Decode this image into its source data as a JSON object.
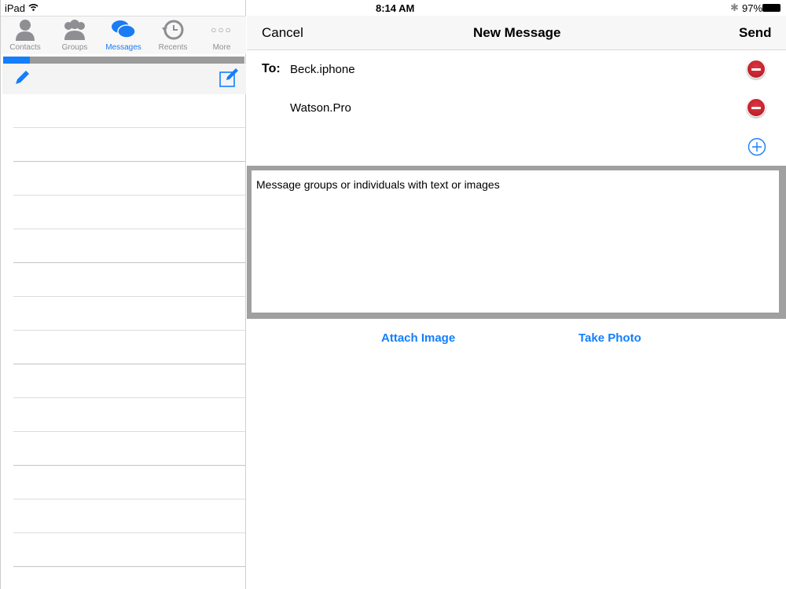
{
  "status": {
    "device": "iPad",
    "time": "8:14 AM",
    "battery": "97%"
  },
  "tabs": [
    {
      "label": "Contacts"
    },
    {
      "label": "Groups"
    },
    {
      "label": "Messages",
      "active": true
    },
    {
      "label": "Recents"
    },
    {
      "label": "More"
    }
  ],
  "progress": {
    "fraction": 0.11
  },
  "nav": {
    "cancel": "Cancel",
    "title": "New Message",
    "send": "Send"
  },
  "recipients": {
    "to_label": "To:",
    "items": [
      "Beck.iphone",
      "Watson.Pro"
    ]
  },
  "message": {
    "text": "Message groups or individuals with text or images"
  },
  "actions": {
    "attach": "Attach Image",
    "photo": "Take Photo"
  },
  "colors": {
    "accent": "#147efb",
    "remove": "#c8202b"
  }
}
